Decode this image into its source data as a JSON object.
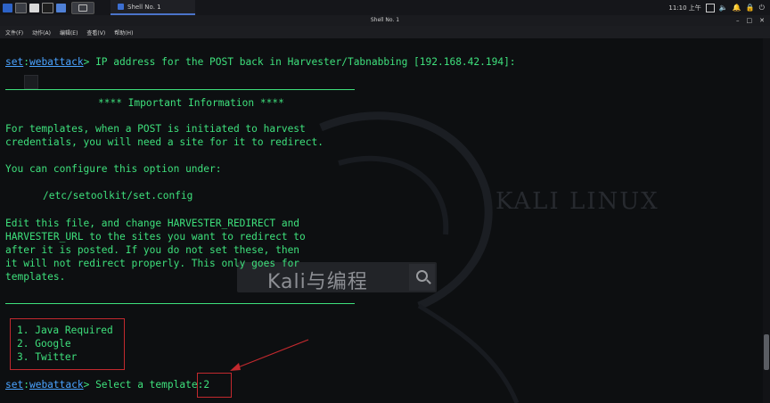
{
  "taskbar": {
    "window_title": "Shell No. 1",
    "clock": "11:10 上午"
  },
  "titlebar": {
    "title": "Shell No. 1"
  },
  "menu": [
    "文件(F)",
    "动作(A)",
    "编辑(E)",
    "查看(V)",
    "帮助(H)"
  ],
  "terminal": {
    "prompt_set": "set",
    "prompt_module": "webattack",
    "line1_text": "> IP address for the POST back in Harvester/Tabnabbing [192.168.42.194]:",
    "important_header": "**** Important Information ****",
    "p1_l1": "For templates, when a POST is initiated to harvest",
    "p1_l2": "credentials, you will need a site for it to redirect.",
    "p2": "You can configure this option under:",
    "path": "/etc/setoolkit/set.config",
    "p3_l1": "Edit this file, and change HARVESTER_REDIRECT and",
    "p3_l2": "HARVESTER_URL to the sites you want to redirect to",
    "p3_l3": "after it is posted. If you do not set these, then",
    "p3_l4": "it will not redirect properly. This only goes for",
    "p3_l5": "templates.",
    "options": [
      "1. Java Required",
      "2. Google",
      "3. Twitter"
    ],
    "final_prompt_text": "> Select a template:",
    "final_input": "2"
  },
  "watermark": {
    "logo_text": "KALI LINUX",
    "search_text": "Kali与编程"
  },
  "colors": {
    "terminal_bg": "#0d0f11",
    "text_green": "#3ee07c",
    "prompt_blue": "#4aa3ff",
    "annotation_red": "#c2292e"
  }
}
